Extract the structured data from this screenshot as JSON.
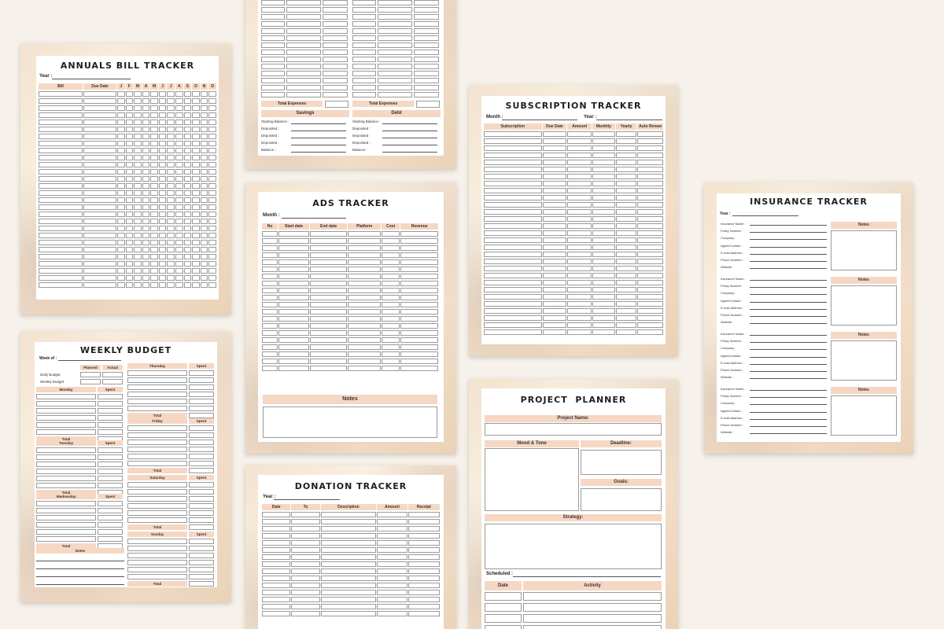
{
  "annual": {
    "title": "ANNUALS BILL TRACKER",
    "year_label": "Year :",
    "columns": [
      "Bill",
      "Due Date",
      "J",
      "F",
      "M",
      "A",
      "M",
      "J",
      "J",
      "A",
      "S",
      "O",
      "N",
      "D"
    ]
  },
  "monthly": {
    "total_expenses_left": "Total Expenses",
    "total_expenses_right": "Total Expenses",
    "savings_title": "Savings",
    "debt_title": "Debt",
    "savings_lines": [
      "Starting Balance :",
      "Deposited :",
      "Deposited :",
      "Deposited :",
      "Balance :"
    ],
    "debt_lines": [
      "Starting Balance :",
      "Deposited :",
      "Deposited :",
      "Deposited :",
      "Balance :"
    ]
  },
  "ads": {
    "title": "ADS TRACKER",
    "month_label": "Month :",
    "columns": [
      "No",
      "Start date",
      "End date",
      "Platform",
      "Cost",
      "Revenue"
    ],
    "notes_label": "Notes"
  },
  "donation": {
    "title": "DONATION TRACKER",
    "year_label": "Year :",
    "columns": [
      "Date",
      "To",
      "Description",
      "Amount",
      "Receipt"
    ]
  },
  "subscription": {
    "title": "SUBSCRIPTION TRACKER",
    "month_label": "Month :",
    "year_label": "Year :",
    "columns": [
      "Subscription",
      "Due Date",
      "Amount",
      "Monthly",
      "Yearly",
      "Auto Renew"
    ]
  },
  "project": {
    "title": "PROJECT  PLANNER",
    "project_name_label": "Project Name:",
    "mood_label": "Mood & Tone",
    "deadline_label": "Deadline:",
    "goals_label": "Goals:",
    "strategy_label": "Strategy:",
    "scheduled_label": "Scheduled :",
    "date_label": "Date",
    "activity_label": "Activity"
  },
  "weekly": {
    "title": "WEEKLY BUDGET",
    "week_label": "Week of :",
    "planned_label": "Planned",
    "actual_label": "Actual",
    "daily_budget": "Daily Budget",
    "weekly_budget": "Weekly Budget",
    "spent_label": "Spent",
    "total_label": "Total",
    "notes_label": "Notes",
    "days_left": [
      "Monday",
      "Tuesday",
      "Wednesday"
    ],
    "days_right": [
      "Thursday",
      "Friday",
      "Saturday",
      "Sunday"
    ]
  },
  "insurance": {
    "title": "INSURANCE TRACKER",
    "year_label": "Year :",
    "notes_label": "Notes",
    "fields": [
      "Insurance Name :",
      "Policy Number :",
      "Company :",
      "Agent/Contact :",
      "E-mail Address :",
      "Phone Number :",
      "Website :"
    ]
  }
}
